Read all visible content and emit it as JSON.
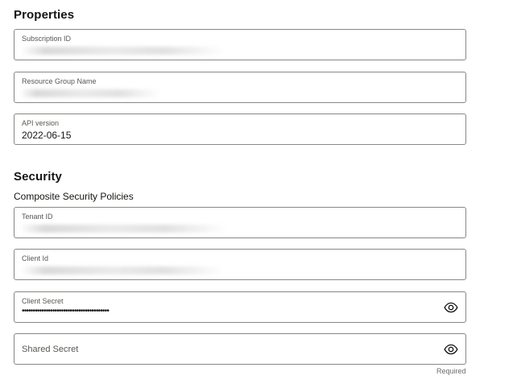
{
  "properties": {
    "title": "Properties",
    "subscription_id": {
      "label": "Subscription ID"
    },
    "resource_group_name": {
      "label": "Resource Group Name"
    },
    "api_version": {
      "label": "API version",
      "value": "2022-06-15"
    }
  },
  "security": {
    "title": "Security",
    "subheading": "Composite Security Policies",
    "tenant_id": {
      "label": "Tenant ID"
    },
    "client_id": {
      "label": "Client Id"
    },
    "client_secret": {
      "label": "Client Secret",
      "masked_value": "••••••••••••••••••••••••••••••••••••••••",
      "toggle_icon": "eye-icon"
    },
    "shared_secret": {
      "placeholder": "Shared Secret",
      "toggle_icon": "eye-icon",
      "required_note": "Required"
    }
  }
}
